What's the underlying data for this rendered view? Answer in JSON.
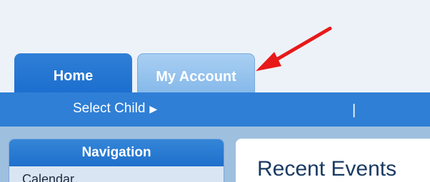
{
  "tabs": [
    {
      "label": "Home",
      "active": true
    },
    {
      "label": "My Account",
      "active": false
    }
  ],
  "subnav": {
    "select_child": "Select Child",
    "chevron_icon": "chevron-right-icon",
    "separator": "|"
  },
  "navigation": {
    "title": "Navigation",
    "items": [
      "Calendar"
    ]
  },
  "recent_events": {
    "title": "Recent Events"
  },
  "annotation": {
    "icon": "red-arrow-icon",
    "color": "#e8191a"
  },
  "colors": {
    "tab_active": "#2f7fd6",
    "tab_inactive": "#a9cff2",
    "subnav": "#2f7fd6",
    "page_bg": "#edf2f9"
  }
}
